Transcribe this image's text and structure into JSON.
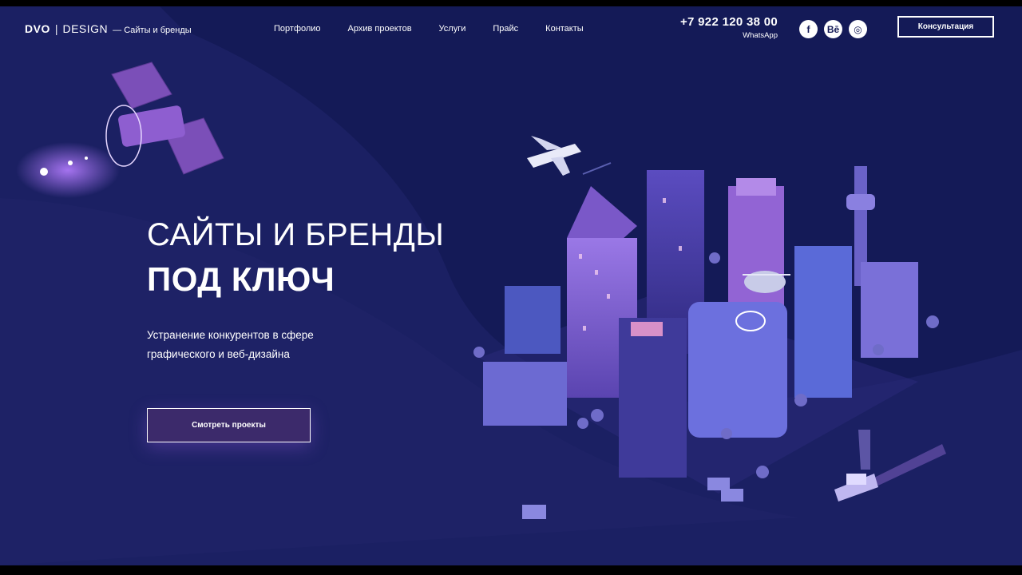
{
  "header": {
    "logo": {
      "part1": "DVO",
      "separator": "|",
      "part2": "DESIGN",
      "tagline": "— Сайты и бренды"
    },
    "nav": [
      {
        "label": "Портфолио"
      },
      {
        "label": "Архив проектов"
      },
      {
        "label": "Услуги"
      },
      {
        "label": "Прайс"
      },
      {
        "label": "Контакты"
      }
    ],
    "phone": "+7 922 120 38 00",
    "phone_note": "WhatsApp",
    "socials": [
      {
        "icon": "facebook-icon",
        "glyph": "f"
      },
      {
        "icon": "behance-icon",
        "glyph": "Bē"
      },
      {
        "icon": "instagram-icon",
        "glyph": "◎"
      }
    ],
    "cta_label": "Консультация"
  },
  "hero": {
    "title_line1": "САЙТЫ И БРЕНДЫ",
    "title_line2": "ПОД КЛЮЧ",
    "subtitle": "Устранение конкурентов в сфере графического и веб-дизайна",
    "button_label": "Смотреть проекты"
  },
  "colors": {
    "background": "#141a57",
    "wave": "#1d2266",
    "accent": "#6a3fb0",
    "building_light": "#8468d8",
    "building_dark": "#3b2f86"
  }
}
